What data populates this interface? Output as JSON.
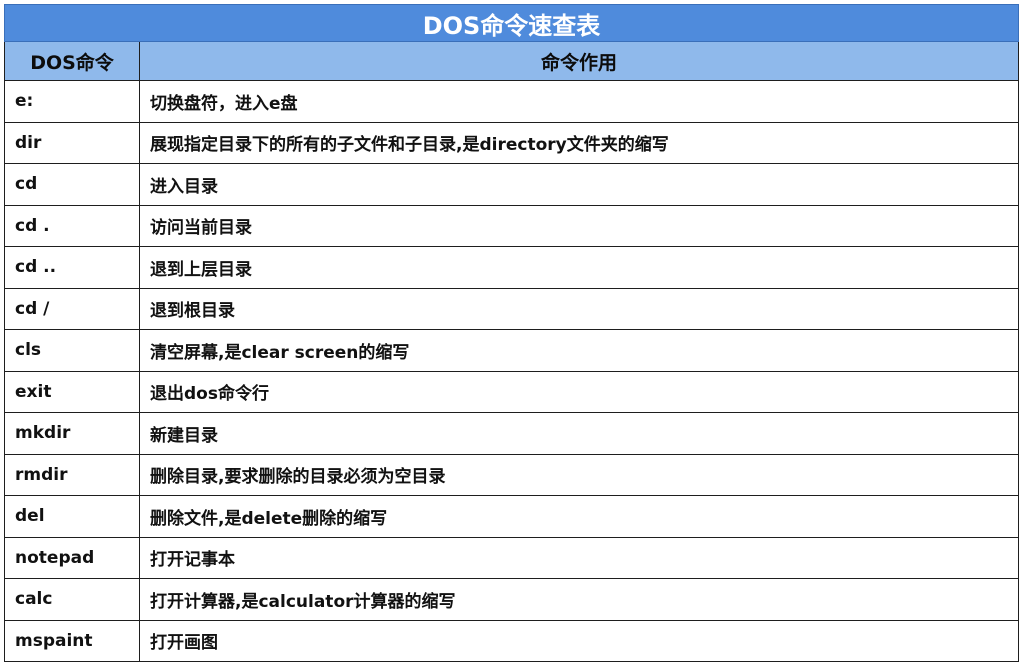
{
  "title": "DOS命令速查表",
  "headers": {
    "command": "DOS命令",
    "description": "命令作用"
  },
  "rows": [
    {
      "command": "e:",
      "description": "切换盘符，进入e盘"
    },
    {
      "command": "dir",
      "description": "展现指定目录下的所有的子文件和子目录,是directory文件夹的缩写"
    },
    {
      "command": "cd",
      "description": "进入目录"
    },
    {
      "command": "cd .",
      "description": "访问当前目录"
    },
    {
      "command": "cd ..",
      "description": "退到上层目录"
    },
    {
      "command": "cd /",
      "description": "退到根目录"
    },
    {
      "command": "cls",
      "description": "清空屏幕,是clear screen的缩写"
    },
    {
      "command": "exit",
      "description": "退出dos命令行"
    },
    {
      "command": "mkdir",
      "description": "新建目录"
    },
    {
      "command": "rmdir",
      "description": "删除目录,要求删除的目录必须为空目录"
    },
    {
      "command": "del",
      "description": "删除文件,是delete删除的缩写"
    },
    {
      "command": "notepad",
      "description": "打开记事本"
    },
    {
      "command": "calc",
      "description": "打开计算器,是calculator计算器的缩写"
    },
    {
      "command": "mspaint",
      "description": "打开画图"
    }
  ],
  "colors": {
    "title_bg": "#4f8bdc",
    "header_bg": "#8fb9eb",
    "border": "#1e1e1e"
  }
}
